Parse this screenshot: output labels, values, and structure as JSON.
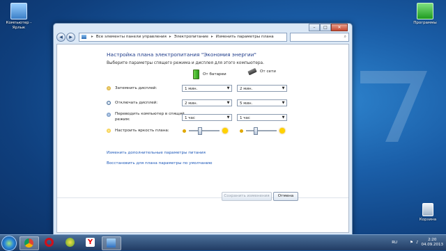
{
  "desktop": {
    "icons": [
      {
        "label": "Компьютер - Ярлык"
      },
      {
        "label": "Программы"
      },
      {
        "label": "Корзина"
      }
    ]
  },
  "window": {
    "controls": {
      "minimize": "–",
      "maximize": "□",
      "close": "✕"
    },
    "nav": {
      "back": "◀",
      "forward": "▶"
    },
    "breadcrumb": [
      "Все элементы панели управления",
      "Электропитание",
      "Изменить параметры плана"
    ],
    "heading": "Настройка плана электропитания \"Экономия энергии\"",
    "subheading": "Выберите параметры спящего режима и дисплея для этого компьютера.",
    "columns": {
      "battery": "От батареи",
      "ac": "От сети"
    },
    "rows": [
      {
        "label": "Затемнить дисплей:",
        "battery": "1 мин.",
        "ac": "2 мин."
      },
      {
        "label": "Отключать дисплей:",
        "battery": "2 мин.",
        "ac": "5 мин."
      },
      {
        "label": "Переводить компьютер в спящий режим:",
        "battery": "1 час",
        "ac": "1 час"
      }
    ],
    "brightness": {
      "label": "Настроить яркость плана:",
      "battery_level": 0.35,
      "ac_level": 0.3
    },
    "links": {
      "advanced": "Изменить дополнительные параметры питания",
      "restore": "Восстановить для плана параметры по умолчанию"
    },
    "buttons": {
      "save": "Сохранить изменения",
      "cancel": "Отмена"
    }
  },
  "tray": {
    "lang": "RU",
    "time": "2:20",
    "date": "04.09.2013"
  }
}
